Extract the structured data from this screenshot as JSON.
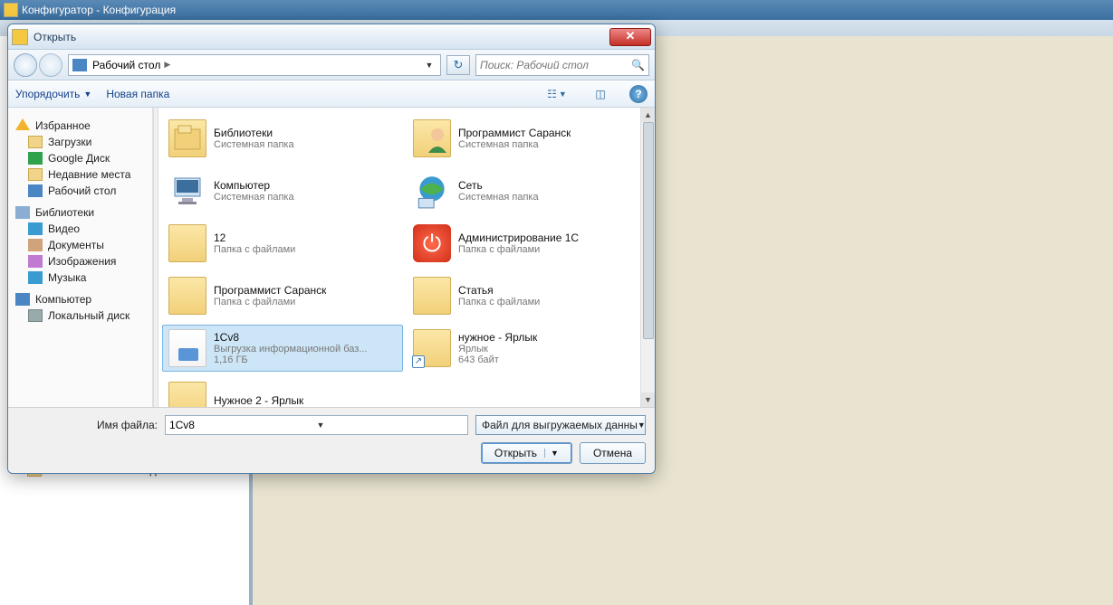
{
  "app": {
    "title": "Конфигуратор - Конфигурация"
  },
  "bg_sidebar": {
    "ext_sources": "Внешние источники данных"
  },
  "dlg": {
    "title": "Открыть",
    "breadcrumb": "Рабочий стол",
    "search_placeholder": "Поиск: Рабочий стол",
    "organize": "Упорядочить",
    "newfolder": "Новая папка",
    "filename_label": "Имя файла:",
    "filename_value": "1Cv8",
    "filetype": "Файл для выгружаемых данны",
    "open": "Открыть",
    "cancel": "Отмена"
  },
  "nav": {
    "favorites": {
      "head": "Избранное",
      "items": [
        "Загрузки",
        "Google Диск",
        "Недавние места",
        "Рабочий стол"
      ]
    },
    "libraries": {
      "head": "Библиотеки",
      "items": [
        "Видео",
        "Документы",
        "Изображения",
        "Музыка"
      ]
    },
    "computer": {
      "head": "Компьютер",
      "items": [
        "Локальный диск"
      ]
    }
  },
  "files": {
    "col1": [
      {
        "name": "Библиотеки",
        "sub": "Системная папка",
        "icon": "lib"
      },
      {
        "name": "Компьютер",
        "sub": "Системная папка",
        "icon": "pc"
      },
      {
        "name": "12",
        "sub": "Папка с файлами",
        "icon": "folder"
      },
      {
        "name": "Программист Саранск",
        "sub": "Папка с файлами",
        "icon": "folder"
      },
      {
        "name": "1Cv8",
        "sub": "Выгрузка информационной баз...",
        "sub2": "1,16 ГБ",
        "icon": "file",
        "selected": true
      },
      {
        "name": "Нужное 2 - Ярлык",
        "sub": "",
        "icon": "folder",
        "shortcut": true
      }
    ],
    "col2": [
      {
        "name": "Программист Саранск",
        "sub": "Системная папка",
        "icon": "user"
      },
      {
        "name": "Сеть",
        "sub": "Системная папка",
        "icon": "net"
      },
      {
        "name": "Администрирование 1С",
        "sub": "Папка с файлами",
        "icon": "red"
      },
      {
        "name": "Статья",
        "sub": "Папка с файлами",
        "icon": "folder"
      },
      {
        "name": "нужное - Ярлык",
        "sub": "Ярлык",
        "sub2": "643 байт",
        "icon": "folder",
        "shortcut": true
      }
    ]
  }
}
